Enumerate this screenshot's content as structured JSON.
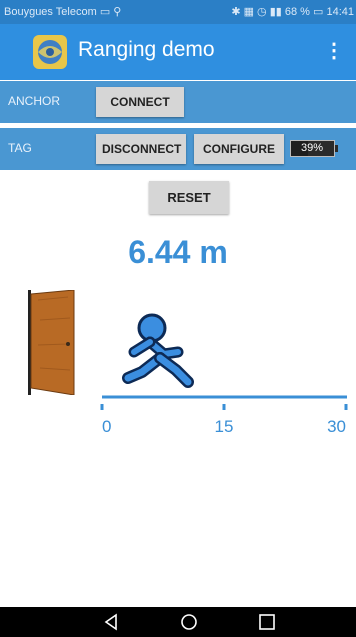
{
  "status_bar": {
    "carrier": "Bouygues Telecom",
    "right_text": "68 %",
    "time": "14:41"
  },
  "app_bar": {
    "title": "Ranging demo",
    "menu_icon": "overflow-menu-icon"
  },
  "anchor_row": {
    "label": "ANCHOR",
    "connect_label": "CONNECT"
  },
  "tag_row": {
    "label": "TAG",
    "disconnect_label": "DISCONNECT",
    "configure_label": "CONFIGURE",
    "battery_text": "39%",
    "battery_level": 0.39
  },
  "reset_label": "RESET",
  "distance_text": "6.44 m",
  "scale": {
    "ticks": [
      "0",
      "15",
      "30"
    ],
    "max_m": 30,
    "runner_position_m": 6.44
  },
  "colors": {
    "status_bar": "#2b7fc6",
    "app_bar": "#2f8fe0",
    "section_bar": "#4a97d2",
    "distance": "#3a8fd6",
    "scale_line": "#3a8fd6"
  },
  "nav": {
    "back_icon": "back-triangle-icon",
    "home_icon": "home-circle-icon",
    "recents_icon": "recents-square-icon"
  }
}
